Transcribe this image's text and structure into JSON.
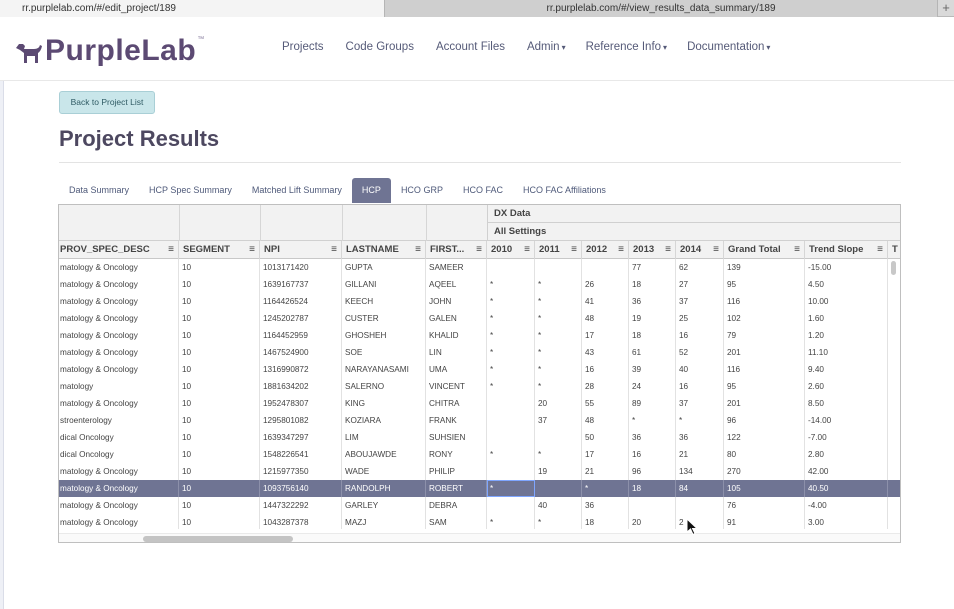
{
  "browser": {
    "tab_active_url": "rr.purplelab.com/#/edit_project/189",
    "tab_inactive_url": "rr.purplelab.com/#/view_results_data_summary/189",
    "new_tab_symbol": "+"
  },
  "header": {
    "logo_text": "PurpleLab",
    "logo_tm": "™",
    "nav": [
      {
        "label": "Projects",
        "caret": ""
      },
      {
        "label": "Code Groups",
        "caret": ""
      },
      {
        "label": "Account Files",
        "caret": ""
      },
      {
        "label": "Admin",
        "caret": "▾"
      },
      {
        "label": "Reference Info",
        "caret": "▾"
      },
      {
        "label": "Documentation",
        "caret": "▾"
      }
    ]
  },
  "back_button": "Back to Project List",
  "page_title": "Project Results",
  "tabs": [
    {
      "label": "Data Summary"
    },
    {
      "label": "HCP Spec Summary"
    },
    {
      "label": "Matched Lift Summary"
    },
    {
      "label": "HCP",
      "active": true
    },
    {
      "label": "HCO GRP"
    },
    {
      "label": "HCO FAC"
    },
    {
      "label": "HCO FAC Affiliations"
    }
  ],
  "grid": {
    "group_dx": "DX Data",
    "group_settings": "All Settings",
    "menu_icon": "≡",
    "columns": [
      "PROV_SPEC_DESC",
      "SEGMENT",
      "NPI",
      "LASTNAME",
      "FIRST...",
      "2010",
      "2011",
      "2012",
      "2013",
      "2014",
      "Grand Total",
      "Trend Slope",
      "T"
    ],
    "rows": [
      [
        "matology & Oncology",
        "10",
        "1013171420",
        "GUPTA",
        "SAMEER",
        "",
        "",
        "",
        "77",
        "62",
        "139",
        "-15.00"
      ],
      [
        "matology & Oncology",
        "10",
        "1639167737",
        "GILLANI",
        "AQEEL",
        "*",
        "*",
        "26",
        "18",
        "27",
        "95",
        "4.50"
      ],
      [
        "matology & Oncology",
        "10",
        "1164426524",
        "KEECH",
        "JOHN",
        "*",
        "*",
        "41",
        "36",
        "37",
        "116",
        "10.00"
      ],
      [
        "matology & Oncology",
        "10",
        "1245202787",
        "CUSTER",
        "GALEN",
        "*",
        "*",
        "48",
        "19",
        "25",
        "102",
        "1.60"
      ],
      [
        "matology & Oncology",
        "10",
        "1164452959",
        "GHOSHEH",
        "KHALID",
        "*",
        "*",
        "17",
        "18",
        "16",
        "79",
        "1.20"
      ],
      [
        "matology & Oncology",
        "10",
        "1467524900",
        "SOE",
        "LIN",
        "*",
        "*",
        "43",
        "61",
        "52",
        "201",
        "11.10"
      ],
      [
        "matology & Oncology",
        "10",
        "1316990872",
        "NARAYANASAMI",
        "UMA",
        "*",
        "*",
        "16",
        "39",
        "40",
        "116",
        "9.40"
      ],
      [
        "matology",
        "10",
        "1881634202",
        "SALERNO",
        "VINCENT",
        "*",
        "*",
        "28",
        "24",
        "16",
        "95",
        "2.60"
      ],
      [
        "matology & Oncology",
        "10",
        "1952478307",
        "KING",
        "CHITRA",
        "",
        "20",
        "55",
        "89",
        "37",
        "201",
        "8.50"
      ],
      [
        "stroenterology",
        "10",
        "1295801082",
        "KOZIARA",
        "FRANK",
        "",
        "37",
        "48",
        "*",
        "*",
        "96",
        "-14.00"
      ],
      [
        "dical Oncology",
        "10",
        "1639347297",
        "LIM",
        "SUHSIEN",
        "",
        "",
        "50",
        "36",
        "36",
        "122",
        "-7.00"
      ],
      [
        "dical Oncology",
        "10",
        "1548226541",
        "ABOUJAWDE",
        "RONY",
        "*",
        "*",
        "17",
        "16",
        "21",
        "80",
        "2.80"
      ],
      [
        "matology & Oncology",
        "10",
        "1215977350",
        "WADE",
        "PHILIP",
        "",
        "19",
        "21",
        "96",
        "134",
        "270",
        "42.00"
      ],
      [
        "matology & Oncology",
        "10",
        "1093756140",
        "RANDOLPH",
        "ROBERT",
        "*",
        "",
        "*",
        "18",
        "84",
        "105",
        "40.50"
      ],
      [
        "matology & Oncology",
        "10",
        "1447322292",
        "GARLEY",
        "DEBRA",
        "",
        "40",
        "36",
        "",
        "",
        "76",
        "-4.00"
      ],
      [
        "matology & Oncology",
        "10",
        "1043287378",
        "MAZJ",
        "SAM",
        "*",
        "*",
        "18",
        "20",
        "2",
        "91",
        "3.00"
      ]
    ],
    "selected_row_index": 13
  }
}
